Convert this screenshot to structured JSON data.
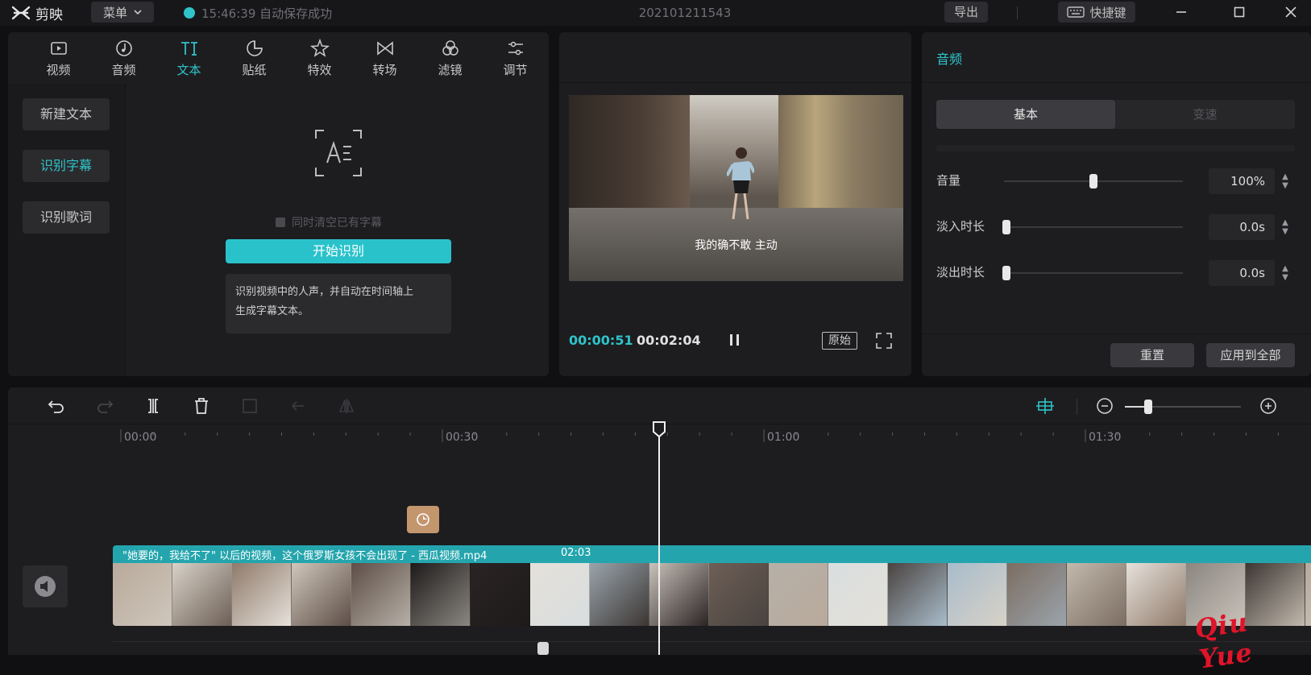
{
  "app": {
    "name": "剪映",
    "menu_label": "菜单",
    "save_status": "15:46:39 自动保存成功",
    "project_name": "202101211543",
    "export_label": "导出",
    "shortcut_label": "快捷键"
  },
  "media_tabs": [
    {
      "label": "视频",
      "icon": "video-icon"
    },
    {
      "label": "音频",
      "icon": "audio-icon"
    },
    {
      "label": "文本",
      "icon": "text-icon"
    },
    {
      "label": "贴纸",
      "icon": "sticker-icon"
    },
    {
      "label": "特效",
      "icon": "effects-icon"
    },
    {
      "label": "转场",
      "icon": "transition-icon"
    },
    {
      "label": "滤镜",
      "icon": "filter-icon"
    },
    {
      "label": "调节",
      "icon": "adjust-icon"
    }
  ],
  "text_side": {
    "new_text": "新建文本",
    "recognize_subtitles": "识别字幕",
    "recognize_lyrics": "识别歌词"
  },
  "recognize": {
    "clear_option": "同时清空已有字幕",
    "start_button": "开始识别",
    "hint_line1": "识别视频中的人声，并自动在时间轴上",
    "hint_line2": "生成字幕文本。"
  },
  "preview": {
    "subtitle": "我的确不敢 主动",
    "current_time": "00:00:51",
    "total_time": "00:02:04",
    "ratio_label": "原始"
  },
  "inspector": {
    "title": "音频",
    "tab_basic": "基本",
    "tab_speed": "变速",
    "volume_label": "音量",
    "volume_value": "100%",
    "volume_level": 0.5,
    "fade_in_label": "淡入时长",
    "fade_in_value": "0.0s",
    "fade_out_label": "淡出时长",
    "fade_out_value": "0.0s",
    "reset_label": "重置",
    "apply_all_label": "应用到全部"
  },
  "timeline": {
    "ruler_labels": [
      "00:00",
      "00:30",
      "01:00",
      "01:30"
    ],
    "clip_name": "\"她要的，我给不了\" 以后的视频，这个俄罗斯女孩不会出现了 - 西瓜视频.mp4",
    "clip_duration": "02:03",
    "playhead_time": "00:51"
  },
  "colors": {
    "accent": "#2ec4c9",
    "clip": "#24a5ad",
    "sticker": "#c3966e"
  },
  "watermark": "Qiu Yue"
}
